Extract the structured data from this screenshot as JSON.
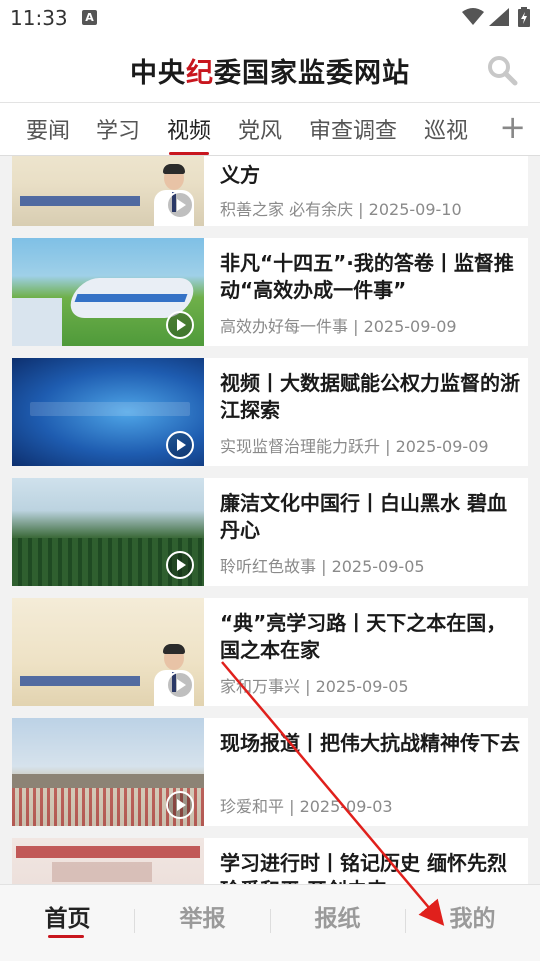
{
  "status_bar": {
    "time": "11:33",
    "notif_icon": "A"
  },
  "header": {
    "title_part1": "中央",
    "title_red": "纪",
    "title_part2": "委国家监委网站",
    "search_icon": "search-icon"
  },
  "tabs": [
    {
      "label": "要闻"
    },
    {
      "label": "学习"
    },
    {
      "label": "视频"
    },
    {
      "label": "党风"
    },
    {
      "label": "审查调查"
    },
    {
      "label": "巡视"
    }
  ],
  "tab_add": "+",
  "active_tab": "视频",
  "articles": [
    {
      "title": "义方",
      "meta": "积善之家 必有余庆 | 2025-09-10",
      "thumb_text": ""
    },
    {
      "title": "非凡“十四五”·我的答卷丨监督推动“高效办成一件事”",
      "meta": "高效办好每一件事 | 2025-09-09",
      "thumb_text": ""
    },
    {
      "title": "视频丨大数据赋能公权力监督的浙江探索",
      "meta": "实现监督治理能力跃升 | 2025-09-09",
      "thumb_text": ""
    },
    {
      "title": "廉洁文化中国行丨白山黑水 碧血丹心",
      "meta": "聆听红色故事 | 2025-09-05",
      "thumb_text": ""
    },
    {
      "title": "“典”亮学习路丨天下之本在国，国之本在家",
      "meta": "家和万事兴 | 2025-09-05",
      "thumb_text": ""
    },
    {
      "title": "现场报道丨把伟大抗战精神传下去",
      "meta": "珍爱和平 | 2025-09-03",
      "thumb_text": ""
    },
    {
      "title": "学习进行时丨铭记历史 缅怀先烈 珍爱和平 开创未来",
      "meta": "",
      "thumb_text": ""
    }
  ],
  "bottom_nav": [
    {
      "label": "首页"
    },
    {
      "label": "举报"
    },
    {
      "label": "报纸"
    },
    {
      "label": "我的"
    }
  ],
  "colors": {
    "accent": "#c8161e",
    "annotation": "#e0201c"
  }
}
